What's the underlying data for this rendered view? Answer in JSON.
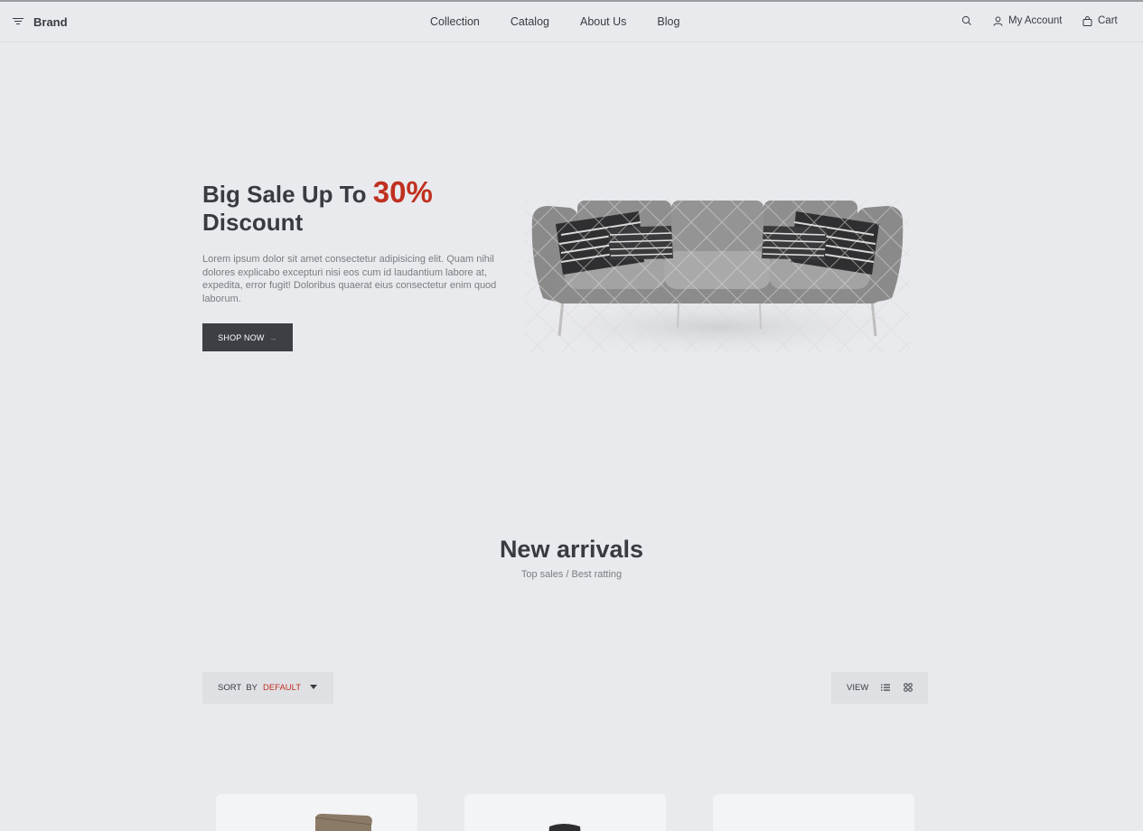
{
  "header": {
    "brand": "Brand",
    "nav": [
      "Collection",
      "Catalog",
      "About Us",
      "Blog"
    ],
    "account_label": "My Account",
    "cart_label": "Cart",
    "icons": [
      "menu-icon",
      "search-icon",
      "user-icon",
      "bag-icon"
    ]
  },
  "hero": {
    "title_prefix": "Big Sale Up To ",
    "title_accent": "30%",
    "title_suffix": "Discount",
    "description": "Lorem ipsum dolor sit amet consectetur adipisicing elit. Quam nihil dolores explicabo excepturi nisi eos cum id laudantium labore at, expedita, error fugit! Doloribus quaerat eius consectetur enim quod laborum.",
    "button_label": "SHOP NOW",
    "accent_color": "#c0301f"
  },
  "section": {
    "title": "New arrivals",
    "subtitle": "Top sales / Best ratting"
  },
  "toolbar": {
    "sort_label": "SORT  BY",
    "sort_value": "DEFAULT",
    "view_label": "VIEW"
  }
}
